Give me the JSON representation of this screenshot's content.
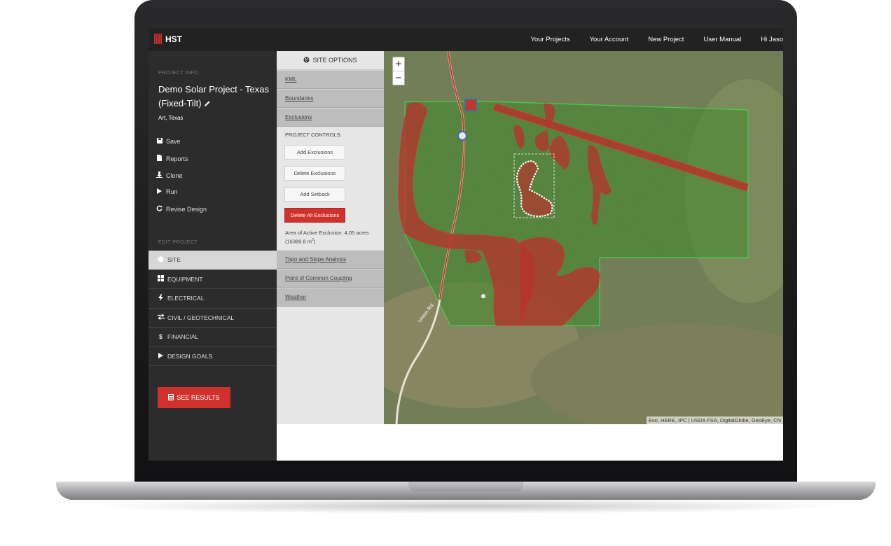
{
  "nav": {
    "brand": "HST",
    "links": [
      "Your Projects",
      "Your Account",
      "New Project",
      "User Manual",
      "Hi Jaso"
    ]
  },
  "sidebar": {
    "project_info_label": "PROJECT INFO",
    "project_title": "Demo Solar Project - Texas (Fixed-Tilt)",
    "project_location": "Art, Texas",
    "actions": [
      {
        "label": "Save",
        "icon": "save-icon"
      },
      {
        "label": "Reports",
        "icon": "file-icon"
      },
      {
        "label": "Clone",
        "icon": "clone-icon"
      },
      {
        "label": "Run",
        "icon": "play-icon"
      },
      {
        "label": "Revise Design",
        "icon": "refresh-icon"
      }
    ],
    "edit_project_label": "EDIT PROJECT",
    "menu": [
      {
        "label": "SITE",
        "icon": "globe-icon",
        "active": true
      },
      {
        "label": "EQUIPMENT",
        "icon": "grid-icon",
        "active": false
      },
      {
        "label": "ELECTRICAL",
        "icon": "bolt-icon",
        "active": false
      },
      {
        "label": "CIVIL / GEOTECHNICAL",
        "icon": "exchange-icon",
        "active": false
      },
      {
        "label": "FINANCIAL",
        "icon": "dollar-icon",
        "active": false
      },
      {
        "label": "DESIGN GOALS",
        "icon": "play-icon",
        "active": false
      }
    ],
    "see_results": "SEE RESULTS"
  },
  "site_options": {
    "title": "SITE OPTIONS",
    "sections_top": [
      "KML",
      "Boundaries",
      "Exclusions"
    ],
    "project_controls_label": "PROJECT CONTROLS:",
    "buttons": [
      "Add Exclusions",
      "Delete Exclusions",
      "Add Setback"
    ],
    "danger_button": "Delete All Exclusions",
    "area_text": "Area of Active Exclusion: 4.05 acres",
    "area_sub": "(16389.8 m",
    "area_sup": "2",
    "area_close": ")",
    "sections_bottom": [
      "Topo and Slope Analysis",
      "Point of Common Coupling",
      "Weather"
    ]
  },
  "map": {
    "zoom_in": "+",
    "zoom_out": "−",
    "road_label": "Union Rd",
    "attribution": "Esri, HERE, IPC | USDA FSA, DigitalGlobe, GeoEye, CN"
  },
  "colors": {
    "accent": "#d0312d",
    "sidebar_bg": "#2c2c2c",
    "nav_bg": "#222222",
    "boundary": "#3fd14a",
    "exclusion": "#c0392b"
  }
}
